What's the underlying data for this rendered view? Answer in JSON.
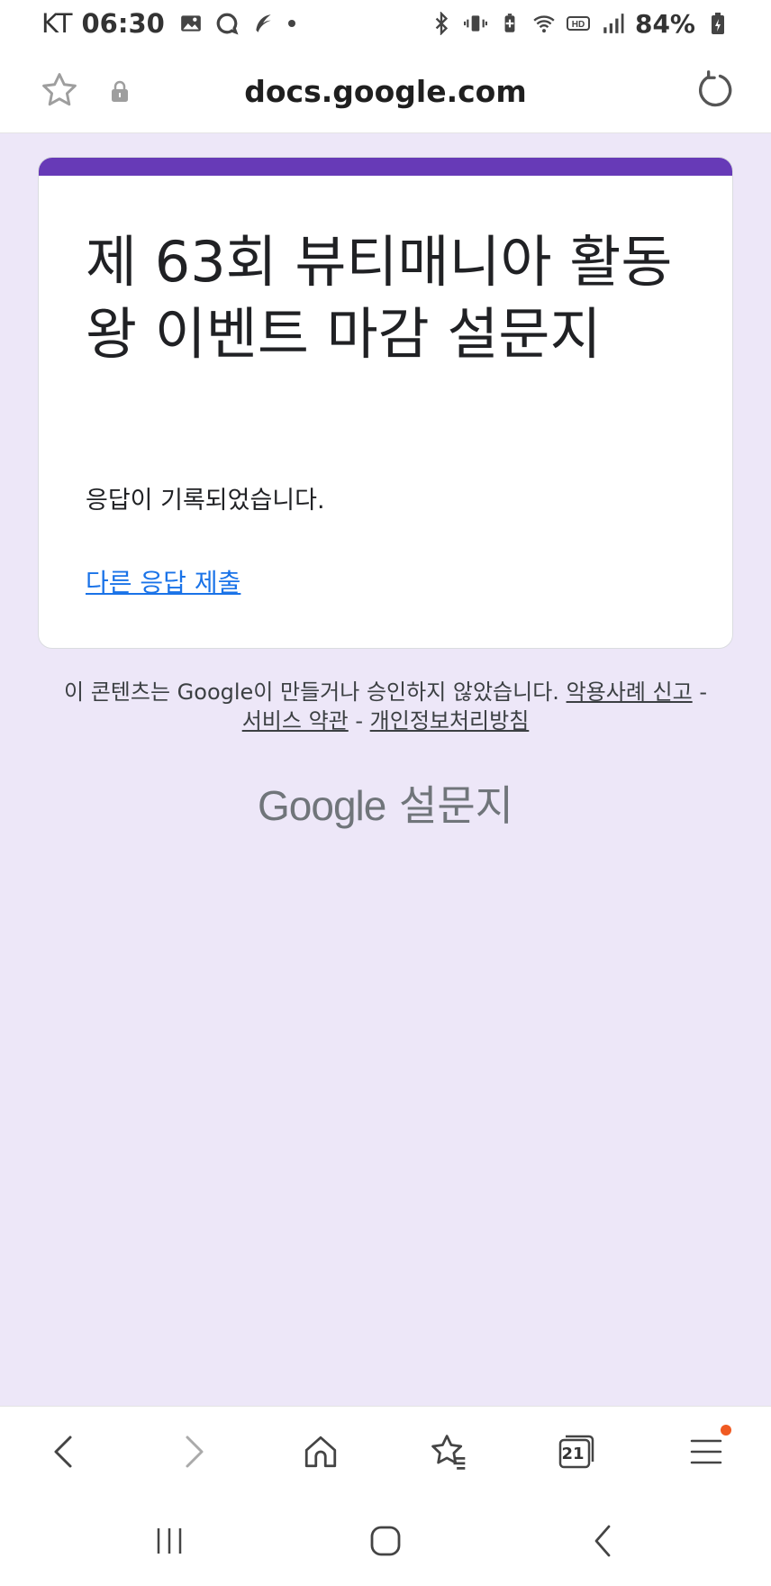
{
  "status_bar": {
    "carrier": "KT",
    "time": "06:30",
    "battery": "84%",
    "icons": [
      "gallery-icon",
      "chat-icon",
      "feather-icon",
      "dot-icon",
      "bluetooth-icon",
      "vibrate-icon",
      "battery-saver-icon",
      "wifi-icon",
      "hd-icon",
      "signal-icon",
      "battery-icon"
    ]
  },
  "url_bar": {
    "domain": "docs.google.com",
    "icons": [
      "star-icon",
      "lock-icon",
      "reload-icon"
    ]
  },
  "form": {
    "accent_color": "#673ab7",
    "title": "제 63회 뷰티매니아 활동왕 이벤트 마감 설문지",
    "confirmation": "응답이 기록되었습니다.",
    "another_response_link": "다른 응답 제출"
  },
  "footer": {
    "disclaimer": "이 콘텐츠는 Google이 만들거나 승인하지 않았습니다.",
    "report_abuse": "악용사례 신고",
    "terms": "서비스 약관",
    "privacy": "개인정보처리방침",
    "separator": " - ",
    "logo_google": "Google",
    "logo_forms": "설문지"
  },
  "browser_toolbar": {
    "tabs_count": "21",
    "icons": [
      "back-icon",
      "forward-icon",
      "home-icon",
      "bookmarks-icon",
      "tabs-icon",
      "menu-icon"
    ]
  },
  "system_nav": {
    "icons": [
      "recents-icon",
      "home-nav-icon",
      "back-nav-icon"
    ]
  },
  "colors": {
    "page_background": "#ede7f8",
    "link": "#1a73e8",
    "notification_dot": "#f05a22"
  }
}
